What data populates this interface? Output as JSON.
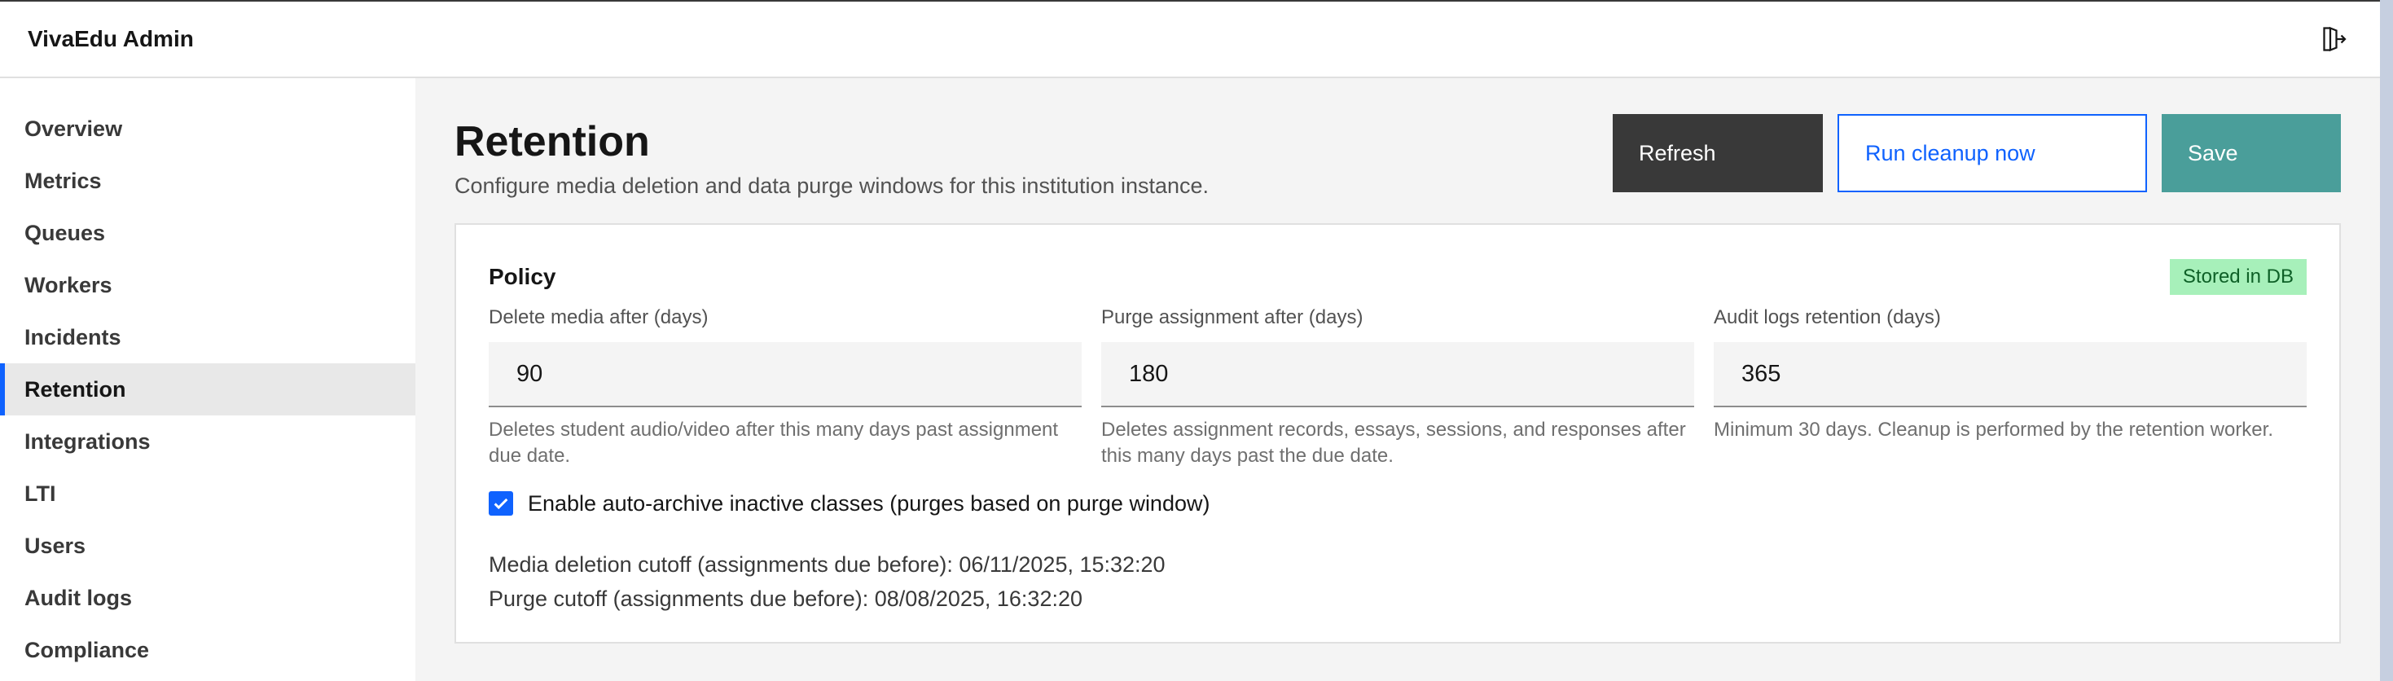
{
  "app": {
    "title": "VivaEdu Admin"
  },
  "sidebar": {
    "items": [
      {
        "label": "Overview"
      },
      {
        "label": "Metrics"
      },
      {
        "label": "Queues"
      },
      {
        "label": "Workers"
      },
      {
        "label": "Incidents"
      },
      {
        "label": "Retention",
        "active": true
      },
      {
        "label": "Integrations"
      },
      {
        "label": "LTI"
      },
      {
        "label": "Users"
      },
      {
        "label": "Audit logs"
      },
      {
        "label": "Compliance"
      }
    ]
  },
  "page": {
    "title": "Retention",
    "subtitle": "Configure media deletion and data purge windows for this institution instance."
  },
  "actions": {
    "refresh_label": "Refresh",
    "cleanup_label": "Run cleanup now",
    "save_label": "Save"
  },
  "policy": {
    "title": "Policy",
    "badge": "Stored in DB",
    "fields": [
      {
        "label": "Delete media after (days)",
        "value": "90",
        "help": "Deletes student audio/video after this many days past assignment due date."
      },
      {
        "label": "Purge assignment after (days)",
        "value": "180",
        "help": "Deletes assignment records, essays, sessions, and responses after this many days past the due date."
      },
      {
        "label": "Audit logs retention (days)",
        "value": "365",
        "help": "Minimum 30 days. Cleanup is performed by the retention worker."
      }
    ],
    "auto_archive": {
      "checked": true,
      "label": "Enable auto-archive inactive classes (purges based on purge window)"
    },
    "media_cutoff": "Media deletion cutoff (assignments due before): 06/11/2025, 15:32:20",
    "purge_cutoff": "Purge cutoff (assignments due before): 08/08/2025, 16:32:20"
  },
  "icons": {
    "logout": "logout-icon",
    "checkbox": "checkmark-icon"
  },
  "colors": {
    "primary": "#0f62fe",
    "save": "#4a9e9a",
    "refresh": "#393939",
    "badge_bg": "#a7f0ba",
    "badge_text": "#0e6027"
  }
}
